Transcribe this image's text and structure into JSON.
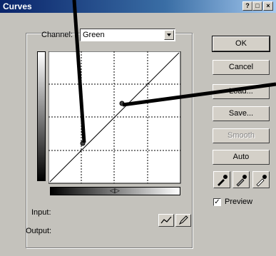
{
  "window": {
    "title": "Curves"
  },
  "titlebar_buttons": {
    "help": "?",
    "maximize": "□",
    "close": "×"
  },
  "channel": {
    "label": "Channel:",
    "value": "Green"
  },
  "buttons": {
    "ok": "OK",
    "cancel": "Cancel",
    "load": "Load...",
    "save": "Save...",
    "smooth": "Smooth",
    "auto": "Auto"
  },
  "preview": {
    "label": "Preview",
    "checked": true
  },
  "readout": {
    "input_label": "Input:",
    "output_label": "Output:"
  },
  "gradient_marker": "◁▷",
  "icons": [
    "black-eyedropper-icon",
    "gray-eyedropper-icon",
    "white-eyedropper-icon",
    "curve-tool-icon",
    "pencil-tool-icon"
  ]
}
